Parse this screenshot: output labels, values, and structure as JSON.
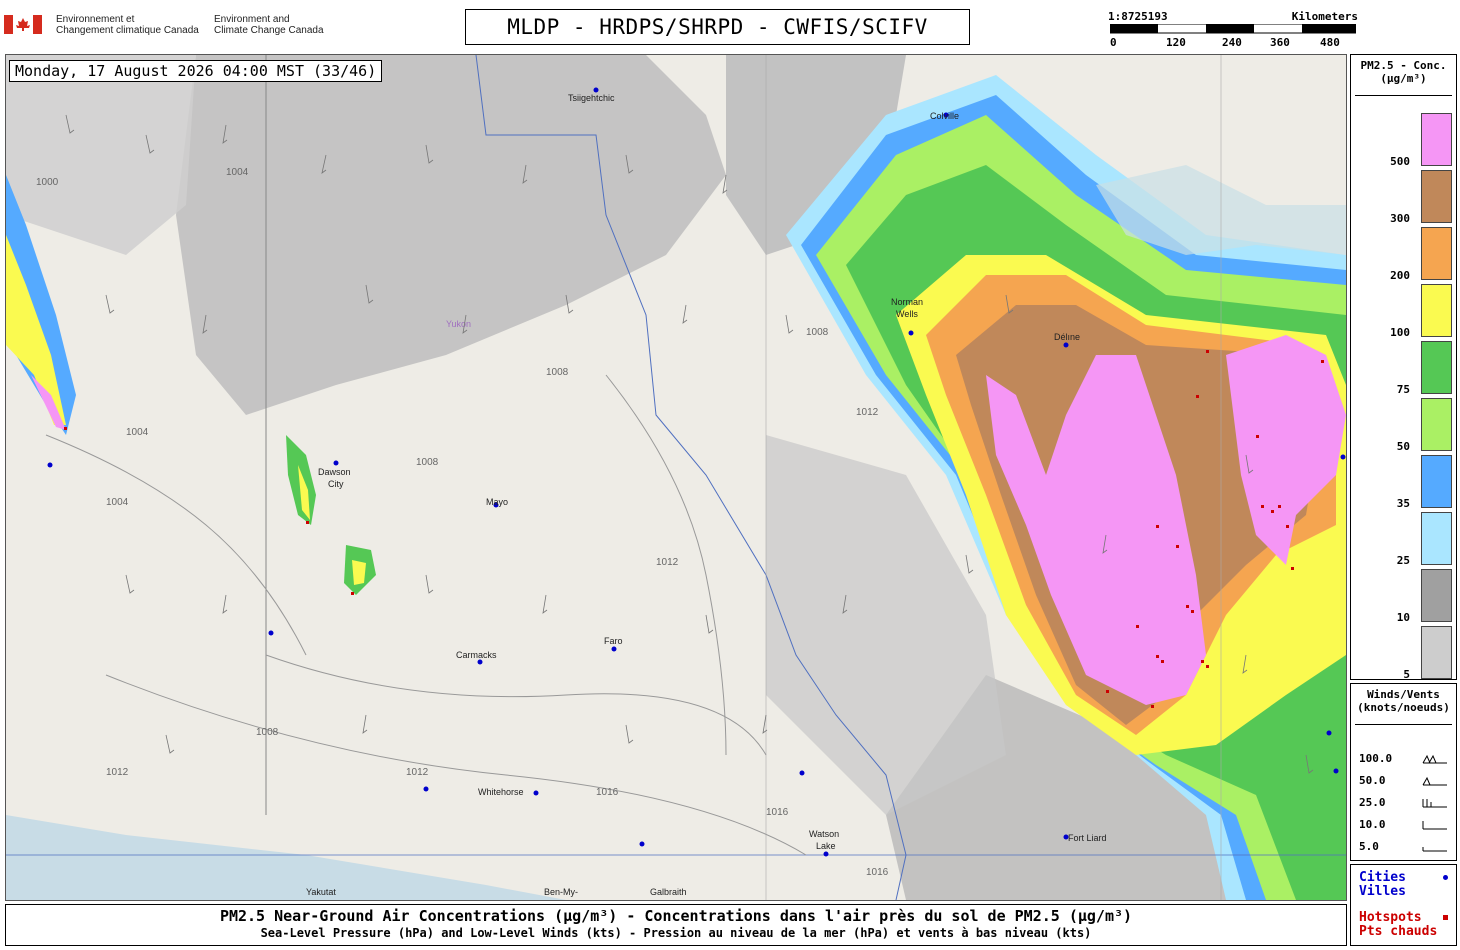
{
  "header": {
    "department_fr_1": "Environnement et",
    "department_fr_2": "Changement climatique Canada",
    "department_en_1": "Environment and",
    "department_en_2": "Climate Change Canada",
    "title": "MLDP - HRDPS/SHRPD - CWFIS/SCIFV"
  },
  "scalebar": {
    "ratio": "1:8725193",
    "unit": "Kilometers",
    "ticks": [
      "0",
      "120",
      "240",
      "360",
      "480"
    ]
  },
  "map": {
    "timestamp": "Monday, 17 August 2026 04:00 MST (33/46)",
    "cities": [
      {
        "name": "Tsiigehtchic"
      },
      {
        "name": "Colville"
      },
      {
        "name": "Norman"
      },
      {
        "name": "Wells"
      },
      {
        "name": "Délıne"
      },
      {
        "name": "Dawson"
      },
      {
        "name": "City"
      },
      {
        "name": "Mayo"
      },
      {
        "name": "Carmacks"
      },
      {
        "name": "Faro"
      },
      {
        "name": "Whitehorse"
      },
      {
        "name": "Watson"
      },
      {
        "name": "Lake"
      },
      {
        "name": "Fort Liard"
      },
      {
        "name": "Yakutat"
      },
      {
        "name": "Ben-My-"
      },
      {
        "name": "Galbraith"
      },
      {
        "name": "Yukon"
      }
    ],
    "isobars": [
      "1000",
      "1004",
      "1004",
      "1008",
      "1008",
      "1008",
      "1012",
      "1012",
      "1012",
      "1016",
      "1016",
      "1004",
      "1008",
      "1012",
      "1016"
    ]
  },
  "pm_legend": {
    "title_line1": "PM2.5 - Conc.",
    "title_line2": "(µg/m³)",
    "classes": [
      {
        "label": "500",
        "color": "#f596f5"
      },
      {
        "label": "300",
        "color": "#c0885a"
      },
      {
        "label": "200",
        "color": "#f5a550"
      },
      {
        "label": "100",
        "color": "#fafa50"
      },
      {
        "label": "75",
        "color": "#55c855"
      },
      {
        "label": "50",
        "color": "#aaf064"
      },
      {
        "label": "35",
        "color": "#55aaff"
      },
      {
        "label": "25",
        "color": "#aae6ff"
      },
      {
        "label": "10",
        "color": "#a0a0a0"
      },
      {
        "label": "5",
        "color": "#cdcdcd"
      }
    ]
  },
  "wind_legend": {
    "title_line1": "Winds/Vents",
    "title_line2": "(knots/noeuds)",
    "rows": [
      "100.0",
      "50.0",
      "25.0",
      "10.0",
      "5.0"
    ]
  },
  "cities_legend": {
    "cities_en": "Cities",
    "cities_fr": "Villes",
    "hotspots_en": "Hotspots",
    "hotspots_fr": "Pts chauds",
    "city_color": "#0000cc",
    "hotspot_color": "#cc0000"
  },
  "caption": {
    "line1": "PM2.5 Near-Ground Air Concentrations (µg/m³) - Concentrations dans l'air près du sol de PM2.5 (µg/m³)",
    "line2": "Sea-Level Pressure (hPa) and Low-Level Winds (kts) - Pression au niveau de la mer (hPa) et vents à bas niveau (kts)"
  }
}
